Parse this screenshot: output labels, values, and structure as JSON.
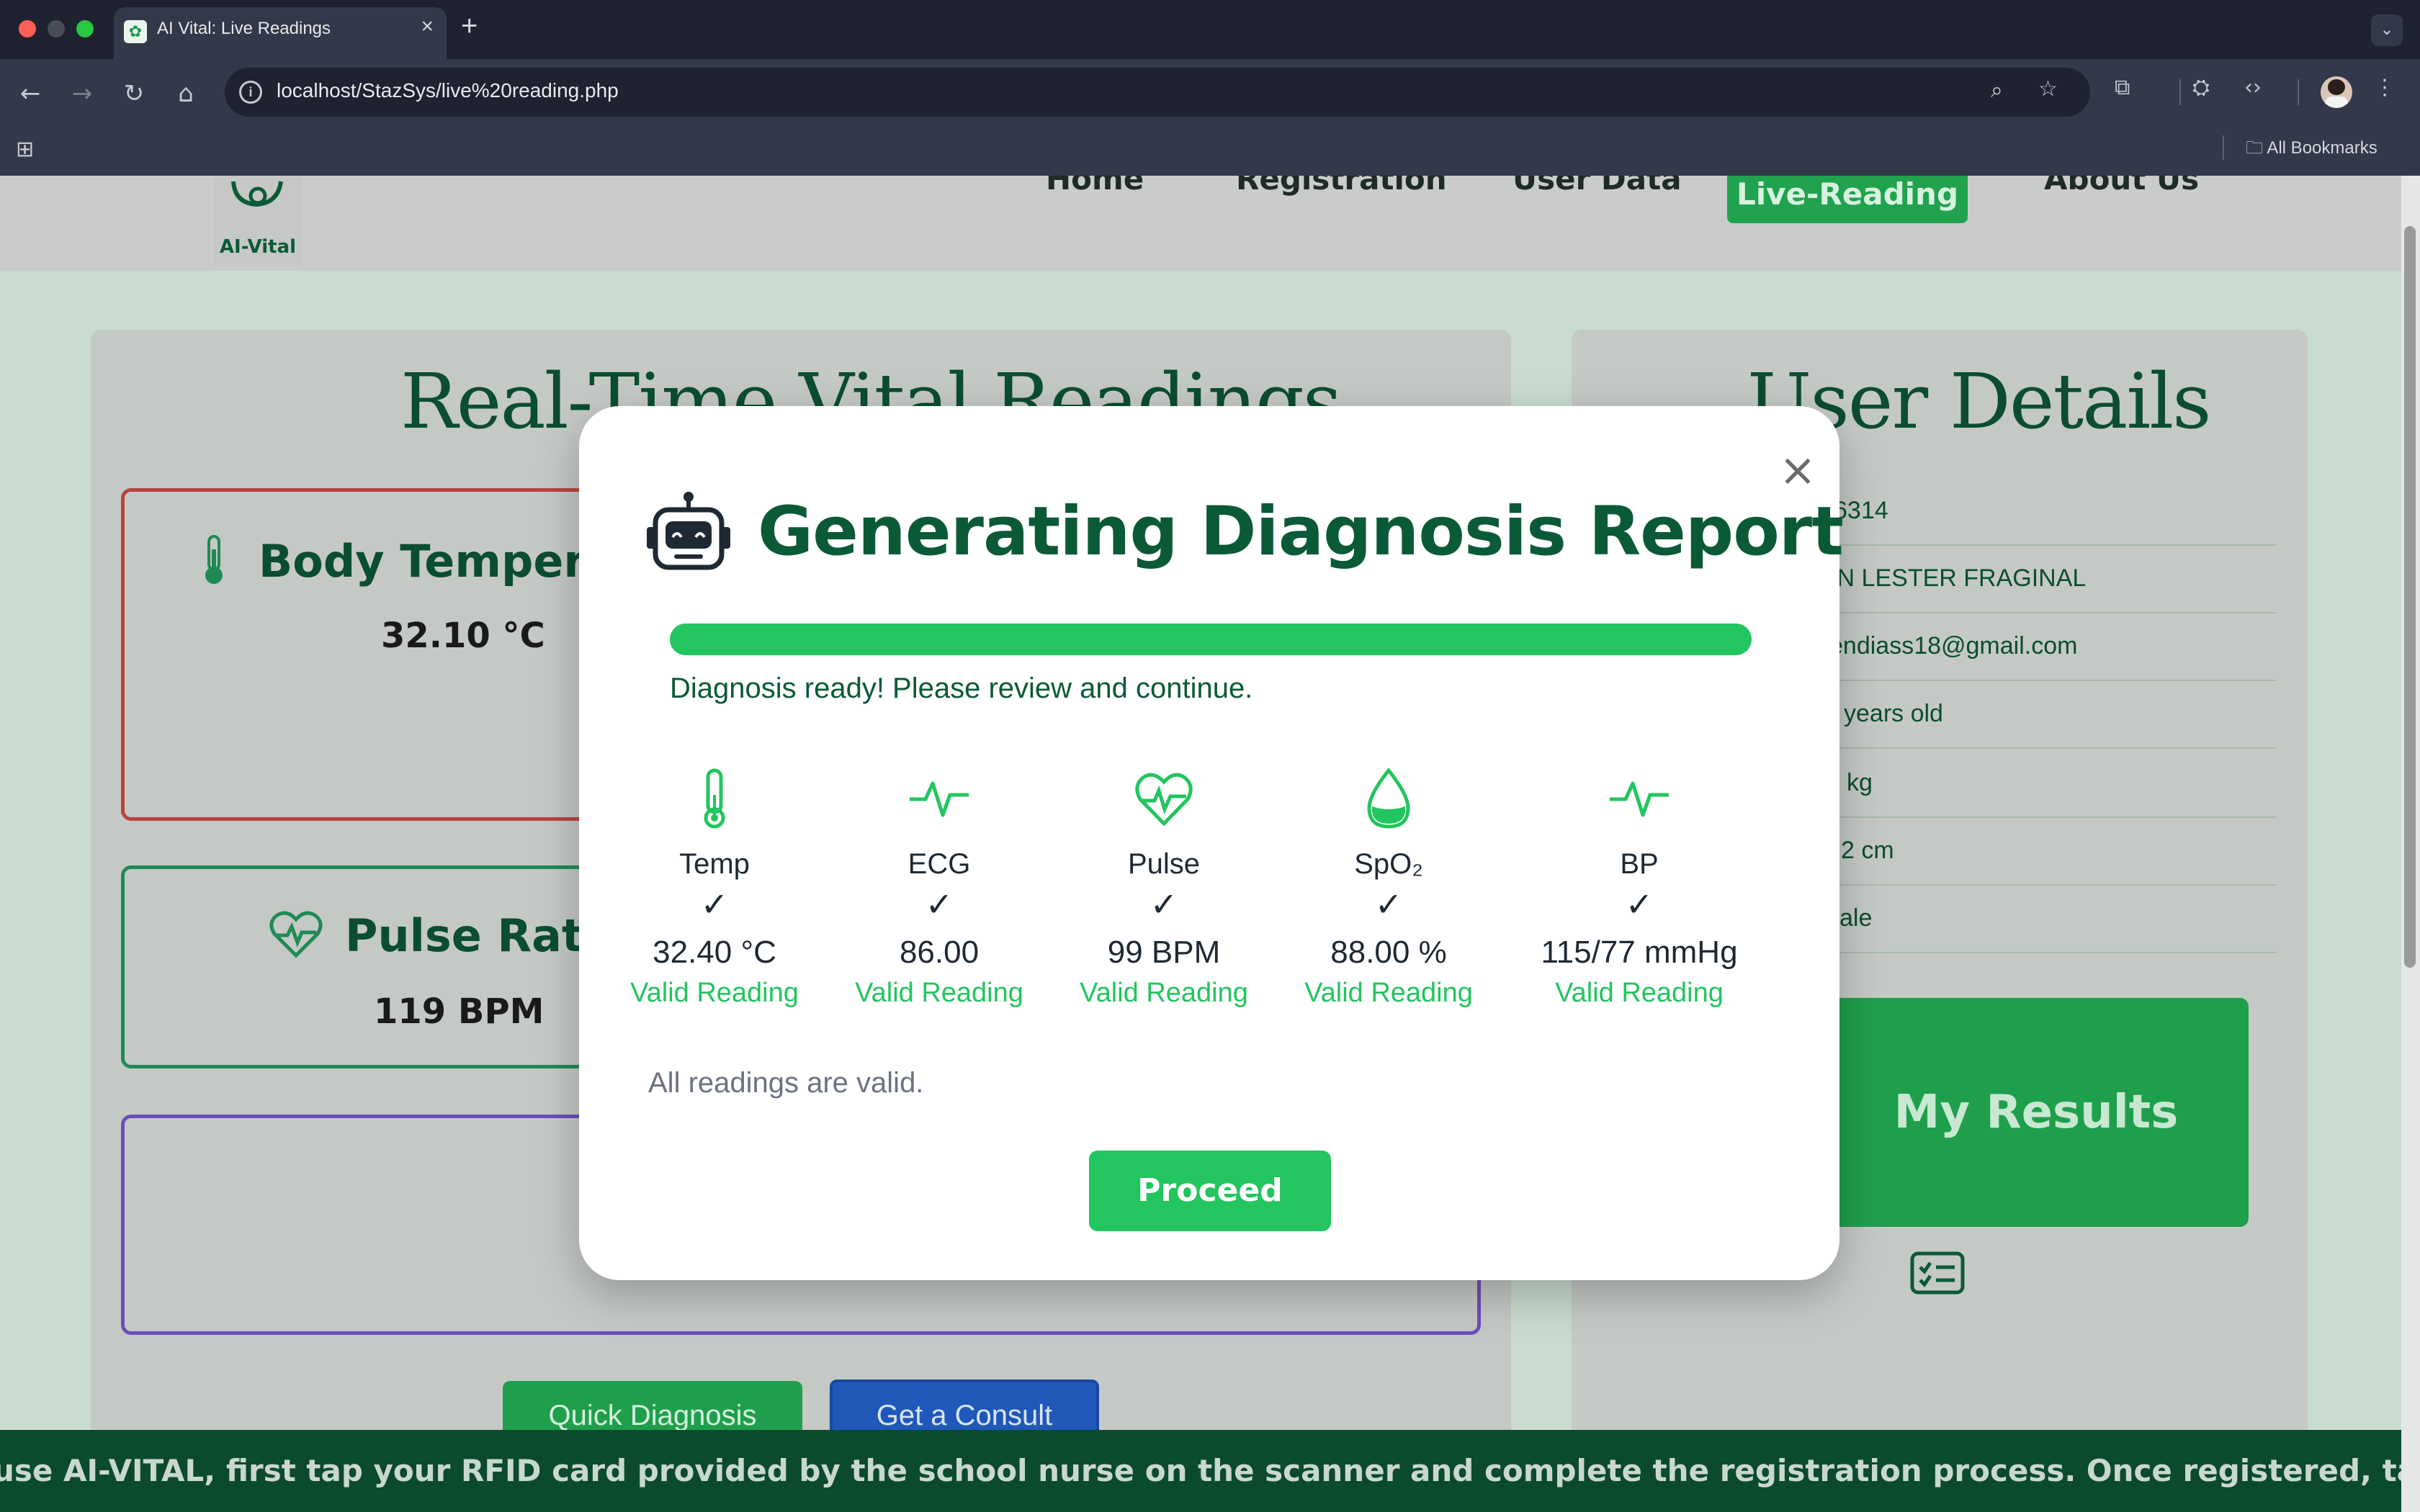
{
  "browser": {
    "tab_title": "AI Vital: Live Readings",
    "tab_close": "×",
    "new_tab": "+",
    "url": "localhost/StazSys/live%20reading.php",
    "all_bookmarks": "All Bookmarks"
  },
  "site": {
    "logo_text": "AI-Vital",
    "nav": {
      "home": "Home",
      "registration": "Registration",
      "user_data": "User Data",
      "live_reading": "Live-Reading",
      "about": "About Us"
    }
  },
  "left_panel": {
    "title": "Real-Time Vital Readings",
    "body_temperature": {
      "label": "Body Temperature",
      "value": "32.10 °C"
    },
    "pulse_rate": {
      "label": "Pulse Rate",
      "value": "119 BPM"
    },
    "quick_diagnosis": "Quick Diagnosis",
    "get_consult": "Get a Consult"
  },
  "right_panel": {
    "title": "User Details",
    "details": [
      "6314",
      "HN LESTER FRAGINAL",
      "endiass18@gmail.com",
      "years old",
      "kg",
      "2 cm",
      "ale"
    ],
    "results_button": "My Results"
  },
  "ticker": "use AI-VITAL, first tap your RFID card provided by the school nurse on the scanner and complete the registration process. Once registered, tap your RFID again to log in.",
  "modal": {
    "close": "×",
    "title": "Generating Diagnosis Report",
    "progress_percent": 100,
    "status": "Diagnosis ready! Please review and continue.",
    "vitals": [
      {
        "label": "Temp",
        "check": "✓",
        "value": "32.40 °C",
        "status": "Valid Reading",
        "icon": "thermometer-icon"
      },
      {
        "label": "ECG",
        "check": "✓",
        "value": "86.00",
        "status": "Valid Reading",
        "icon": "ecg-icon"
      },
      {
        "label": "Pulse",
        "check": "✓",
        "value": "99 BPM",
        "status": "Valid Reading",
        "icon": "heart-pulse-icon"
      },
      {
        "label": "SpO₂",
        "check": "✓",
        "value": "88.00 %",
        "status": "Valid Reading",
        "icon": "droplet-icon"
      },
      {
        "label": "BP",
        "check": "✓",
        "value": "115/77 mmHg",
        "status": "Valid Reading",
        "icon": "bp-pulse-icon"
      }
    ],
    "summary": "All readings are valid.",
    "proceed": "Proceed"
  },
  "colors": {
    "accent_green": "#22c55e",
    "dark_green": "#0b5a37",
    "consult_blue": "#1f58b8"
  }
}
